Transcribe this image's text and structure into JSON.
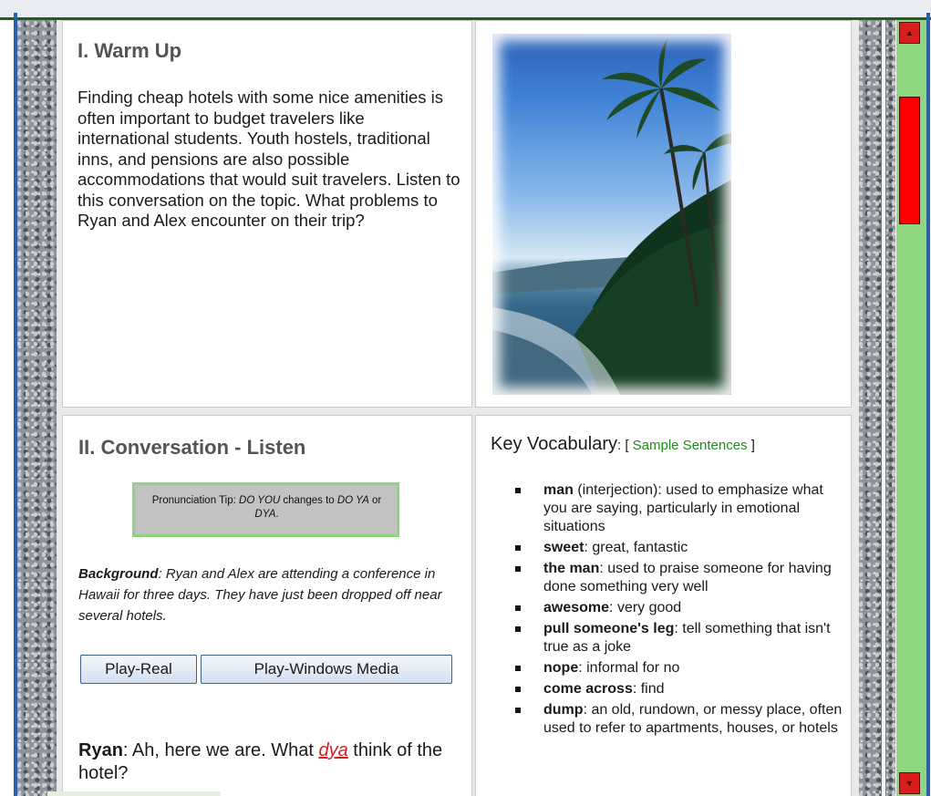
{
  "warm_up": {
    "title": "I. Warm Up",
    "text": "Finding cheap hotels with some nice amenities is often important to budget travelers like international students. Youth hostels, traditional inns, and pensions are also possible accommodations that would suit travelers. Listen to this conversation on the topic. What problems to Ryan and Alex encounter on their trip?"
  },
  "conversation": {
    "title": "II. Conversation - Listen",
    "tip": {
      "prefix": "Pronunciation Tip: ",
      "phrase": "DO YOU",
      "middle": " changes to ",
      "form1": "DO YA",
      "or": " or ",
      "form2": "DYA",
      "end": "."
    },
    "background_label": "Background",
    "background_text": ": Ryan and Alex are attending a conference in Hawaii for three days. They have just been dropped off near several hotels.",
    "buttons": {
      "real": "Play-Real",
      "windows_media": "Play-Windows Media"
    },
    "first_line": {
      "speaker": "Ryan",
      "before": ": Ah, here we are. What ",
      "link": "dya",
      "after": " think of the hotel?"
    }
  },
  "vocabulary": {
    "title": "Key Vocabulary",
    "open_bracket": ": [ ",
    "link": "Sample Sentences",
    "close_bracket": " ]",
    "items": [
      {
        "term": "man",
        "definition": " (interjection): used to emphasize what you are saying, particularly in emotional situations"
      },
      {
        "term": "sweet",
        "definition": ": great, fantastic"
      },
      {
        "term": "the man",
        "definition": ": used to praise someone for having done something very well"
      },
      {
        "term": "awesome",
        "definition": ": very good"
      },
      {
        "term": "pull someone's leg",
        "definition": ": tell something that isn't true as a joke"
      },
      {
        "term": "nope",
        "definition": ": informal for no"
      },
      {
        "term": "come across",
        "definition": ": find"
      },
      {
        "term": "dump",
        "definition": ": an old, rundown, or messy place, often used to refer to apartments, houses, or hotels"
      }
    ]
  },
  "scrollbar": {
    "track_color": "#8fd681",
    "thumb_color": "#ff0000"
  }
}
